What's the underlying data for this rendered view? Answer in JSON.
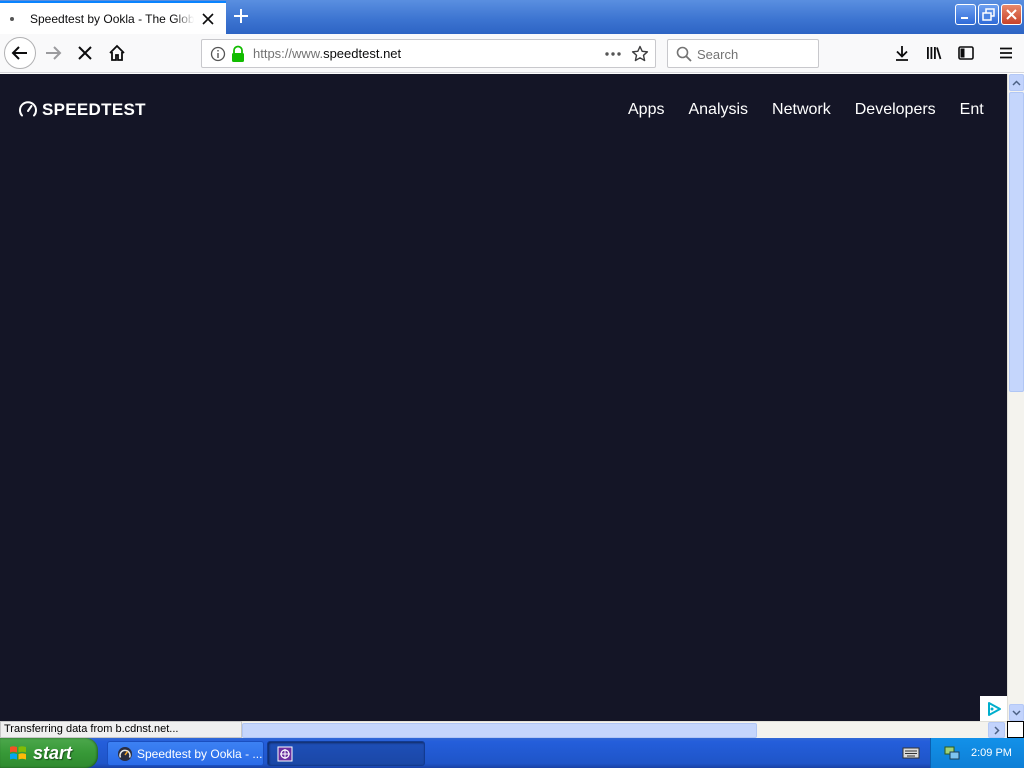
{
  "browser": {
    "tab": {
      "title": "Speedtest by Ookla - The Global Broadband Speed Test"
    },
    "url": {
      "prefix": "https://www.",
      "domain": "speedtest.net"
    },
    "search": {
      "placeholder": "Search"
    },
    "status_text": "Transferring data from b.cdnst.net..."
  },
  "page": {
    "logo_text": "SPEEDTEST",
    "nav_items": [
      "Apps",
      "Analysis",
      "Network",
      "Developers",
      "Ent"
    ],
    "background_color": "#141526"
  },
  "taskbar": {
    "start_label": "start",
    "task_firefox_label": "Speedtest by Ookla - ...",
    "clock": "2:09 PM"
  },
  "icons": [
    "info-icon",
    "lock-icon",
    "more-icon",
    "star-icon",
    "search-icon",
    "download-icon",
    "library-icon",
    "sidebar-icon",
    "menu-icon",
    "back-icon",
    "forward-icon",
    "stop-icon",
    "home-icon",
    "close-icon",
    "plus-icon"
  ]
}
